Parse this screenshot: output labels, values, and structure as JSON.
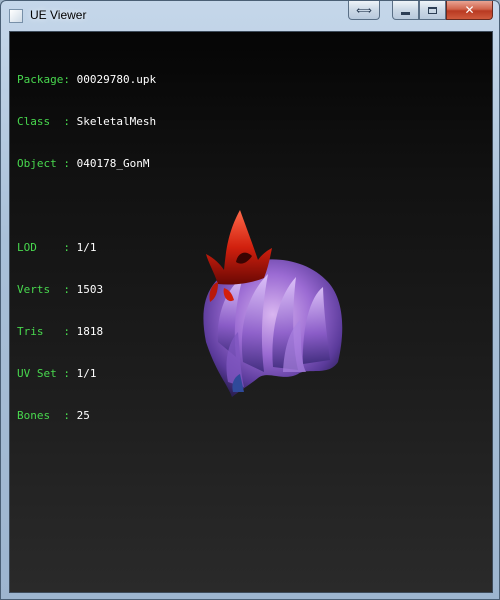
{
  "window": {
    "title": "UE Viewer",
    "buttons": {
      "restore": "⟺",
      "close": "✕"
    }
  },
  "info": [
    {
      "label": "Package:",
      "value": "00029780.upk"
    },
    {
      "label": "Class  :",
      "value": "SkeletalMesh"
    },
    {
      "label": "Object :",
      "value": "040178_GonM"
    }
  ],
  "stats": [
    {
      "label": "LOD    :",
      "value": "1/1"
    },
    {
      "label": "Verts  :",
      "value": "1503"
    },
    {
      "label": "Tris   :",
      "value": "1818"
    },
    {
      "label": "UV Set :",
      "value": "1/1"
    },
    {
      "label": "Bones  :",
      "value": "25"
    }
  ],
  "colors": {
    "label": "#48d84e",
    "value": "#ffffff",
    "viewport_top": "#050505",
    "viewport_bottom": "#2a2a2a"
  }
}
